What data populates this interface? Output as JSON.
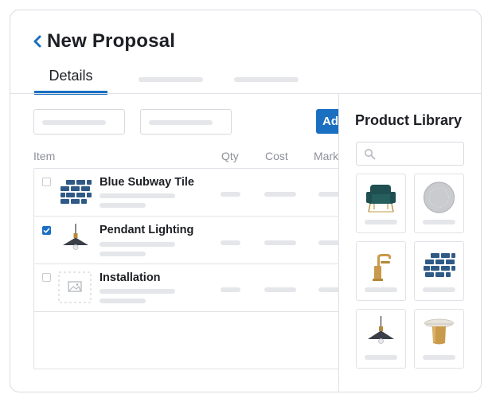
{
  "header": {
    "title": "New Proposal",
    "back_icon": "chevron-left-icon"
  },
  "tabs": [
    {
      "label": "Details",
      "active": true
    }
  ],
  "toolbar": {
    "add_label": "Ad"
  },
  "table": {
    "columns": [
      "Item",
      "Qty",
      "Cost",
      "Mark"
    ],
    "rows": [
      {
        "name": "Blue Subway Tile",
        "checked": false,
        "icon": "subway-tile-icon"
      },
      {
        "name": "Pendant Lighting",
        "checked": true,
        "icon": "pendant-lamp-icon"
      },
      {
        "name": "Installation",
        "checked": false,
        "icon": "image-placeholder-icon"
      }
    ]
  },
  "library": {
    "title": "Product Library",
    "search_icon": "search-icon",
    "products": [
      "armchair-icon",
      "round-rug-icon",
      "faucet-icon",
      "subway-tile-icon",
      "pendant-lamp-icon",
      "side-table-icon"
    ]
  },
  "colors": {
    "accent": "#1a6fc1",
    "tile_blue": "#2f5a86",
    "placeholder": "#e4e6ea",
    "border": "#dfe2e6"
  }
}
